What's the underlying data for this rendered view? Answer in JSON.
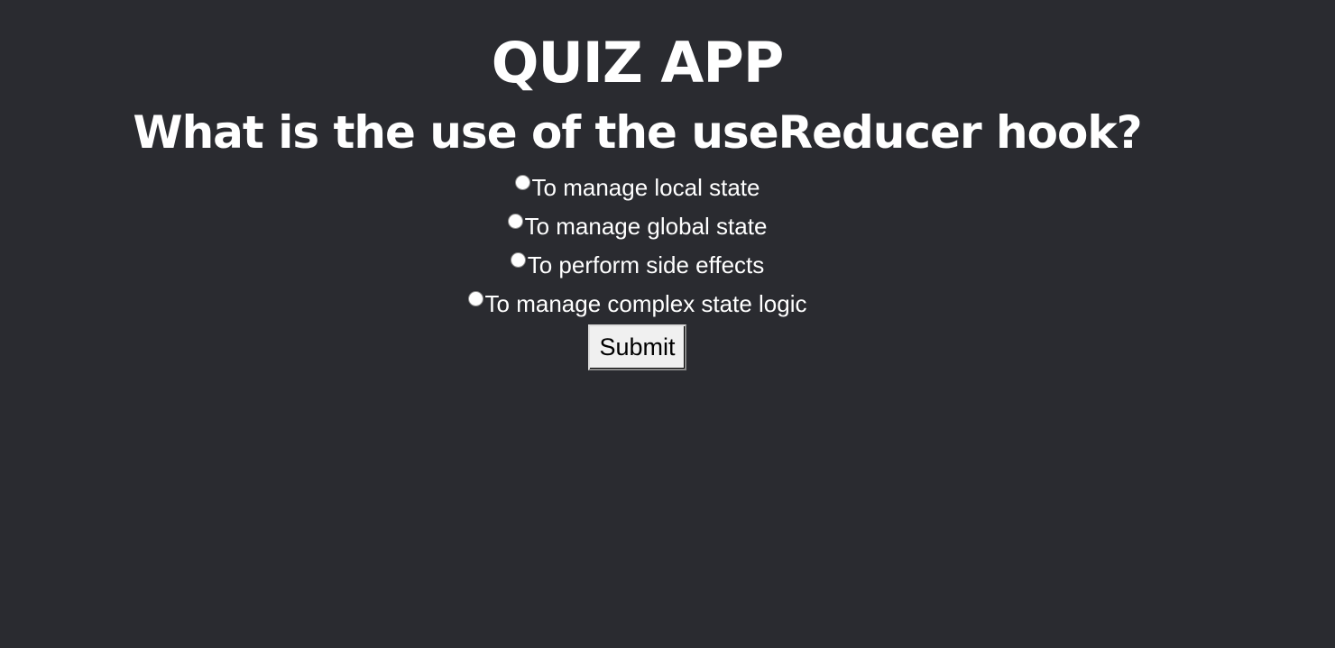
{
  "app": {
    "title": "QUIZ APP"
  },
  "quiz": {
    "question": "What is the use of the useReducer hook?",
    "options": [
      "To manage local state",
      "To manage global state",
      "To perform side effects",
      "To manage complex state logic"
    ],
    "selected_index": null,
    "submit_label": "Submit"
  },
  "colors": {
    "background": "#2a2b30",
    "text": "#ffffff",
    "button_bg": "#f0f0f0"
  }
}
